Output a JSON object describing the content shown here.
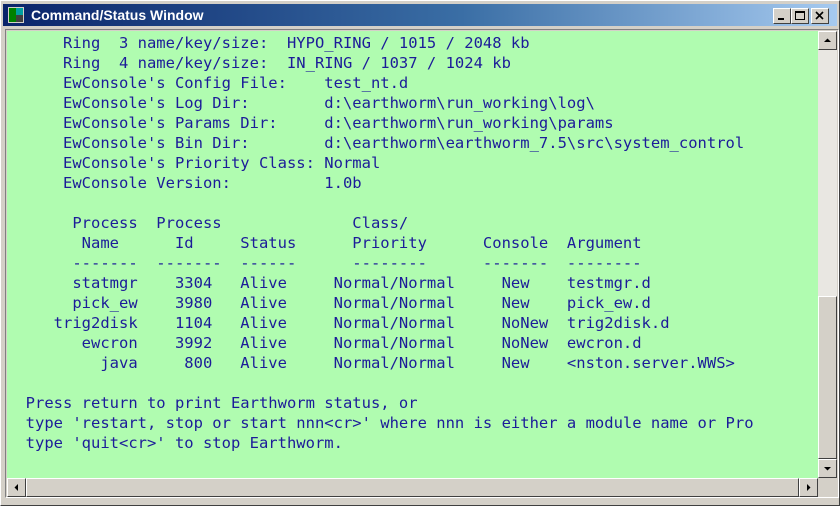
{
  "window": {
    "title": "Command/Status Window",
    "app_icon": "earthworm-console-icon",
    "controls": [
      "minimize-icon",
      "maximize-icon",
      "close-icon"
    ]
  },
  "console": {
    "text_color": "#1c1c99",
    "background_color": "#b0fcb0",
    "lines": [
      "      Ring  3 name/key/size:  HYPO_RING / 1015 / 2048 kb",
      "      Ring  4 name/key/size:  IN_RING / 1037 / 1024 kb",
      "      EwConsole's Config File:    test_nt.d",
      "      EwConsole's Log Dir:        d:\\earthworm\\run_working\\log\\",
      "      EwConsole's Params Dir:     d:\\earthworm\\run_working\\params",
      "      EwConsole's Bin Dir:        d:\\earthworm\\earthworm_7.5\\src\\system_control",
      "      EwConsole's Priority Class: Normal",
      "      EwConsole Version:          1.0b",
      "",
      "       Process  Process              Class/",
      "        Name      Id     Status      Priority      Console  Argument",
      "       -------  -------  ------      --------      -------  --------",
      "       statmgr    3304   Alive     Normal/Normal     New    testmgr.d",
      "       pick_ew    3980   Alive     Normal/Normal     New    pick_ew.d",
      "     trig2disk    1104   Alive     Normal/Normal     NoNew  trig2disk.d",
      "        ewcron    3992   Alive     Normal/Normal     NoNew  ewcron.d",
      "          java     800   Alive     Normal/Normal     New    <nston.server.WWS>",
      "",
      "  Press return to print Earthworm status, or",
      "  type 'restart, stop or start nnn<cr>' where nnn is either a module name or Pro",
      "  type 'quit<cr>' to stop Earthworm."
    ]
  },
  "scrollbars": {
    "vertical_up": "scroll-up-arrow-icon",
    "vertical_down": "scroll-down-arrow-icon",
    "horizontal_left": "scroll-left-arrow-icon",
    "horizontal_right": "scroll-right-arrow-icon"
  }
}
